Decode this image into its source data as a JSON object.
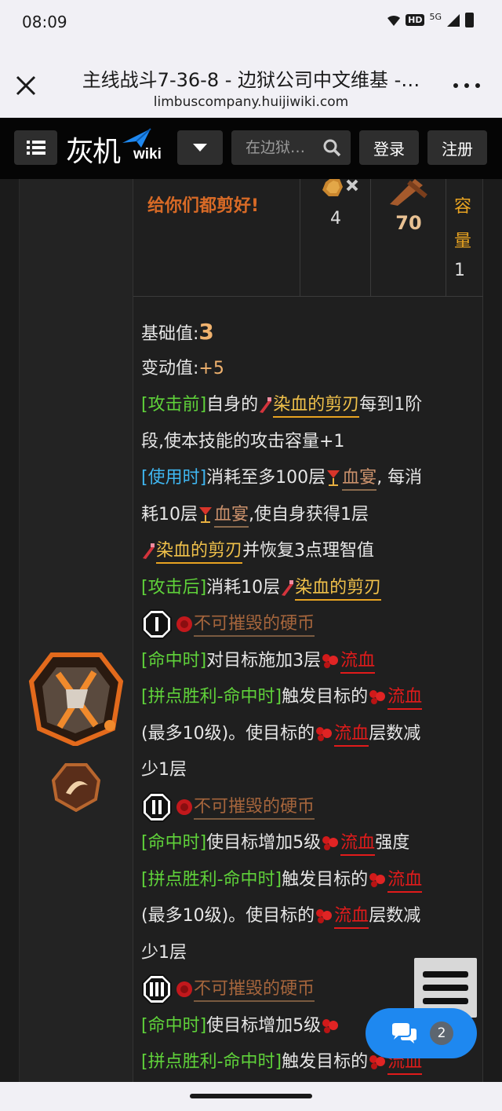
{
  "status": {
    "time": "08:09",
    "hd": "HD",
    "network": "5G"
  },
  "browser": {
    "title": "主线战斗7-36-8 - 边狱公司中文维基 -…",
    "url": "limbuscompany.huijiwiki.com"
  },
  "site": {
    "logo_text": "灰机",
    "logo_wiki": "wiki",
    "search_placeholder": "在边狱…",
    "login": "登录",
    "register": "注册"
  },
  "skill": {
    "name": "给你们都剪好!",
    "coin_count": "4",
    "attack": "70",
    "capacity_label": "容量",
    "capacity_value": "1",
    "base_label": "基础值:",
    "base_value": "3",
    "var_label": "变动值:",
    "var_value": "+5"
  },
  "desc": {
    "l3a": "[攻击前]",
    "l3b": "自身的",
    "l3c": "染血的剪刃",
    "l3d": "每到1阶",
    "l4": "段,使本技能的攻击容量+1",
    "l5a": "[使用时]",
    "l5b": "消耗至多100层",
    "l5c": "血宴",
    "l5d": ", 每消",
    "l6a": "耗10层",
    "l6b": "血宴",
    "l6c": ",使自身获得1层",
    "l7a": "染血的剪刃",
    "l7b": "并恢复3点理智值",
    "l8a": "[攻击后]",
    "l8b": "消耗10层",
    "l8c": "染血的剪刃",
    "coin_name": "不可摧毁的硬币",
    "c1a": "[命中时]",
    "c1b": "对目标施加3层",
    "c1c": "流血",
    "c1d": "[拼点胜利-命中时]",
    "c1e": "触发目标的",
    "c1f": "流血",
    "c1g": "(最多10级)。使目标的",
    "c1h": "流血",
    "c1i": "层数减",
    "c1j": "少1层",
    "c2a": "[命中时]",
    "c2b": "使目标增加5级",
    "c2c": "流血",
    "c2d": "强度",
    "c2e": "[拼点胜利-命中时]",
    "c2f": "触发目标的",
    "c2g": "流血",
    "c2h": "(最多10级)。使目标的",
    "c2i": "流血",
    "c2j": "层数减",
    "c2k": "少1层",
    "c3a": "[命中时]",
    "c3b": "使目标增加5级",
    "c3d": "[拼点胜利-命中时]",
    "c3e": "触发目标的",
    "c3f": "流血"
  },
  "chat": {
    "count": "2"
  },
  "colors": {
    "accent_orange": "#d86a26",
    "tag_green": "#5fd23a",
    "tag_blue": "#3fb6f0",
    "bleed_red": "#e11b1b",
    "link_gold": "#f0c14a",
    "chat_blue": "#1e88f0"
  }
}
